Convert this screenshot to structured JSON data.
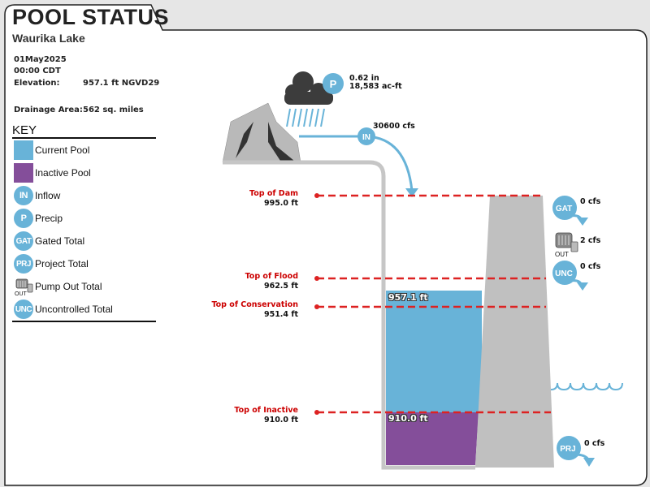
{
  "header": {
    "title": "POOL STATUS",
    "subtitle": "Waurika Lake"
  },
  "info": {
    "date": "01May2025",
    "time": "00:00 CDT",
    "elevation_label": "Elevation:",
    "elevation_value": "957.1 ft NGVD29",
    "drainage_label": "Drainage Area:",
    "drainage_value": "562 sq. miles"
  },
  "key": {
    "title": "KEY",
    "items": [
      {
        "type": "swatch",
        "color": "#68b3d8",
        "label": "Current Pool"
      },
      {
        "type": "swatch",
        "color": "#844e9a",
        "label": "Inactive Pool"
      },
      {
        "type": "badge",
        "abbr": "IN",
        "label": "Inflow"
      },
      {
        "type": "badge",
        "abbr": "P",
        "label": "Precip"
      },
      {
        "type": "badge",
        "abbr": "GAT",
        "label": "Gated Total"
      },
      {
        "type": "badge",
        "abbr": "PRJ",
        "label": "Project Total"
      },
      {
        "type": "pump",
        "abbr": "OUT",
        "label": "Pump Out Total"
      },
      {
        "type": "badge",
        "abbr": "UNC",
        "label": "Uncontrolled Total"
      }
    ]
  },
  "levels": {
    "top_of_dam": {
      "name": "Top of Dam",
      "value": "995.0 ft"
    },
    "top_of_flood": {
      "name": "Top of Flood",
      "value": "962.5 ft"
    },
    "top_of_conservation": {
      "name": "Top of Conservation",
      "value": "951.4 ft"
    },
    "top_of_inactive": {
      "name": "Top of Inactive",
      "value": "910.0 ft"
    }
  },
  "pool": {
    "current_label": "957.1 ft",
    "inactive_label": "910.0 ft"
  },
  "flows": {
    "precip_abbr": "P",
    "precip_depth": "0.62 in",
    "precip_volume": "18,583 ac-ft",
    "inflow_abbr": "IN",
    "inflow": "30600 cfs",
    "gated_abbr": "GAT",
    "gated": "0 cfs",
    "pump_abbr": "OUT",
    "pump": "2 cfs",
    "uncontrolled_abbr": "UNC",
    "uncontrolled": "0 cfs",
    "project_abbr": "PRJ",
    "project": "0 cfs"
  },
  "colors": {
    "current_pool": "#68b3d8",
    "inactive_pool": "#844e9a",
    "level_line": "#dd2222",
    "dam": "#c0c0c0"
  }
}
